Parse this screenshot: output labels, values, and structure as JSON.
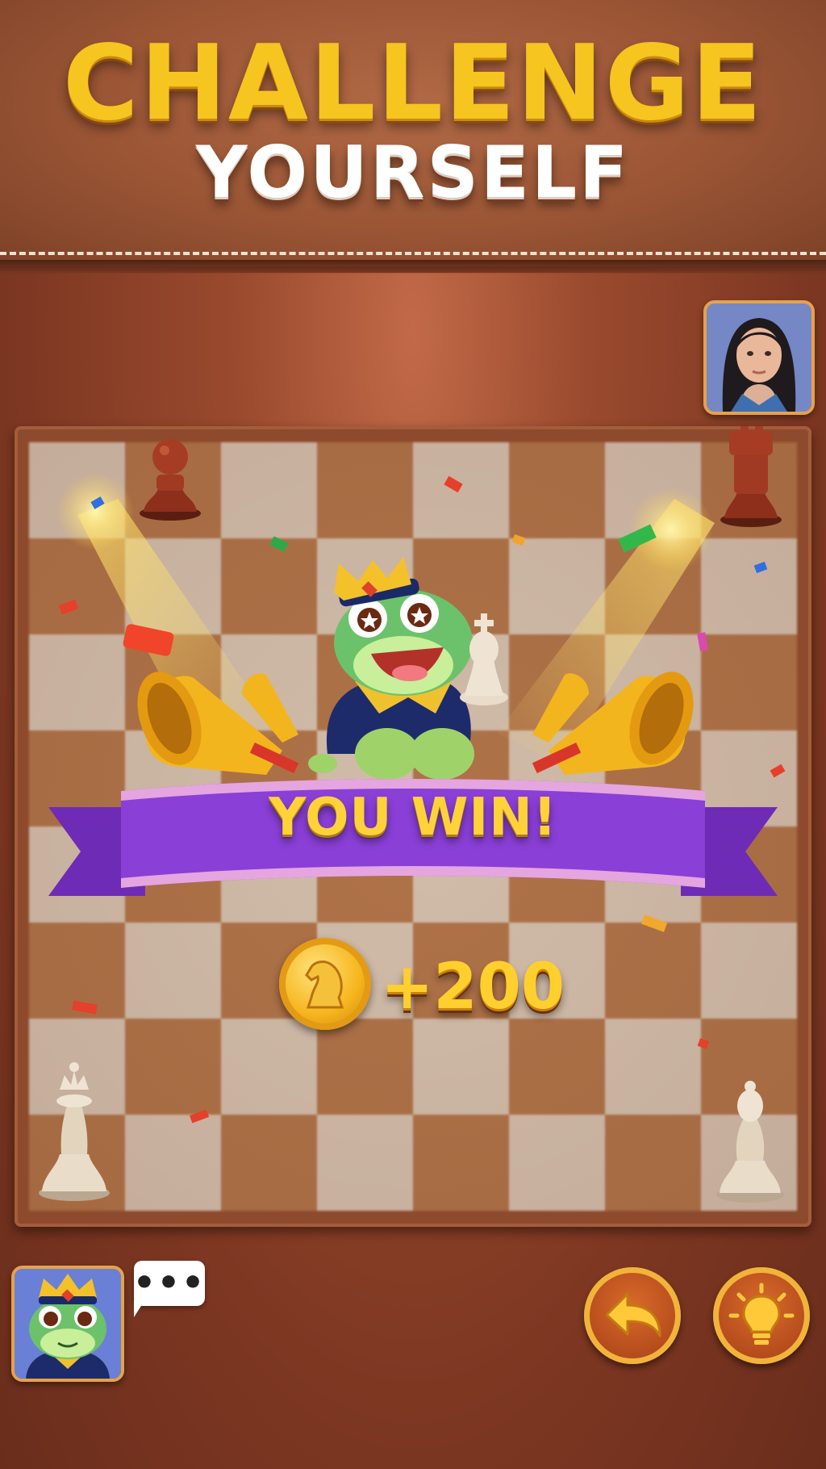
{
  "header": {
    "title": "CHALLENGE",
    "subtitle": "YOURSELF"
  },
  "result": {
    "banner_text": "YOU WIN!",
    "reward_text": "+200",
    "coin_icon": "knight-coin-icon"
  },
  "opponent": {
    "avatar_icon": "opponent-girl-avatar"
  },
  "player": {
    "avatar_icon": "frog-king-avatar",
    "chat_text": "•••"
  },
  "controls": {
    "undo_icon": "undo-arrow-icon",
    "hint_icon": "lightbulb-icon"
  },
  "colors": {
    "title_gold": "#f6c520",
    "ribbon_purple": "#8a3fd6",
    "board_light": "#d8c5b3",
    "board_dark": "#b4774c",
    "button_orange": "#b34a1c"
  }
}
